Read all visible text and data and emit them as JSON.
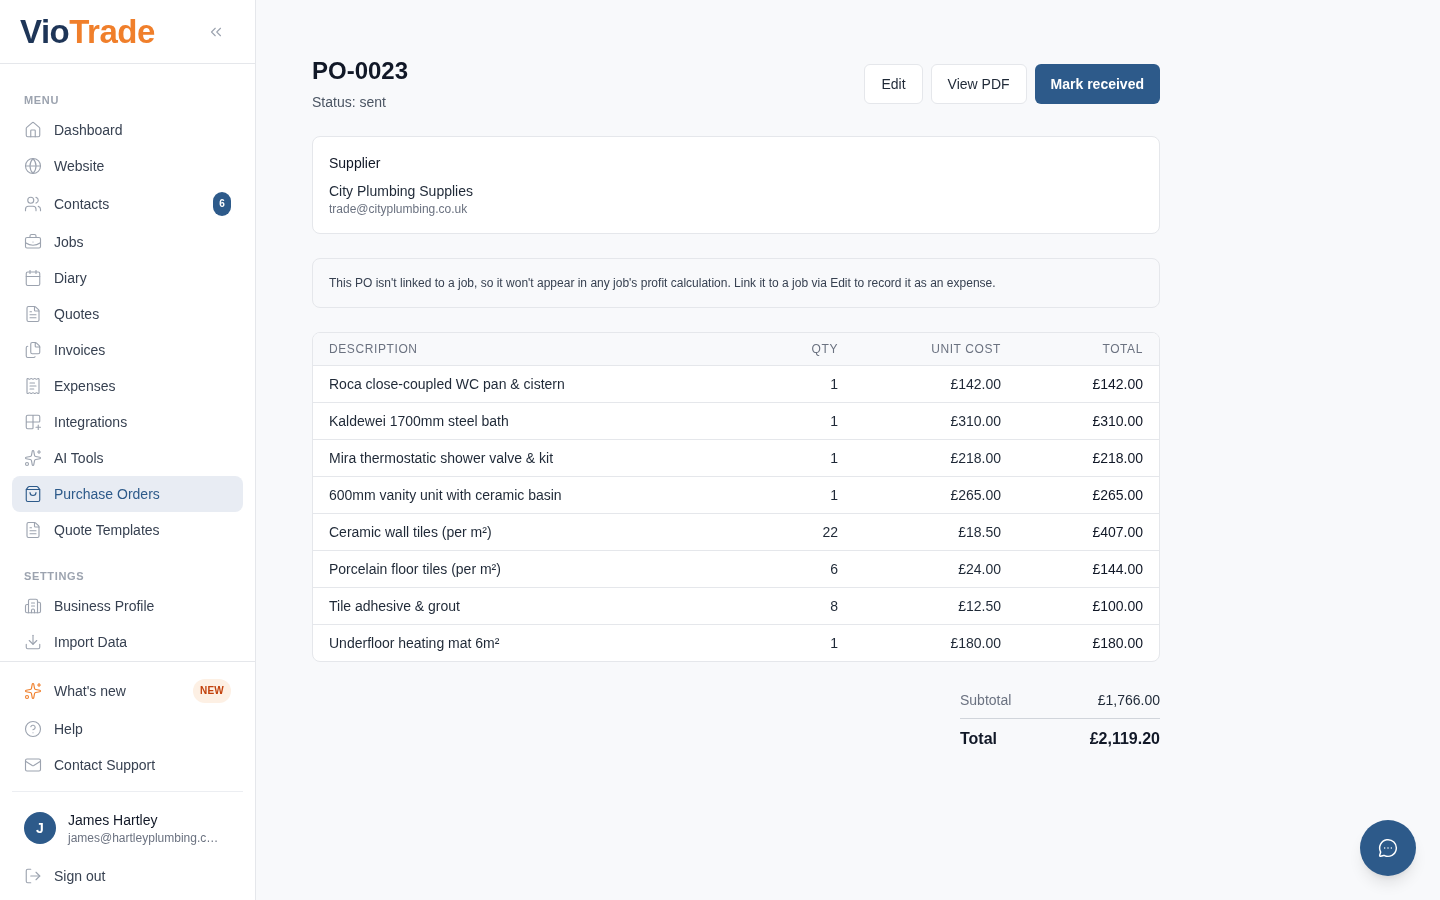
{
  "sidebar": {
    "logo": {
      "dark_part": "Vio",
      "accent_part": "Trade"
    },
    "sections": [
      {
        "heading": "MENU",
        "items": [
          {
            "label": "Dashboard",
            "selected": false
          },
          {
            "label": "Website",
            "selected": false
          },
          {
            "label": "Contacts",
            "selected": false,
            "badge": {
              "text": "6",
              "kind": "count"
            }
          },
          {
            "label": "Jobs",
            "selected": false
          },
          {
            "label": "Diary",
            "selected": false
          },
          {
            "label": "Quotes",
            "selected": false
          },
          {
            "label": "Invoices",
            "selected": false
          },
          {
            "label": "Expenses",
            "selected": false
          },
          {
            "label": "Integrations",
            "selected": false
          },
          {
            "label": "AI Tools",
            "selected": false
          },
          {
            "label": "Purchase Orders",
            "selected": true
          },
          {
            "label": "Quote Templates",
            "selected": false
          }
        ]
      },
      {
        "heading": "SETTINGS",
        "items": [
          {
            "label": "Business Profile",
            "selected": false
          },
          {
            "label": "Import Data",
            "selected": false
          }
        ]
      }
    ],
    "footer_items": [
      {
        "label": "What's new",
        "selected": false,
        "badge": {
          "text": "NEW",
          "kind": "new"
        }
      },
      {
        "label": "Help",
        "selected": false
      },
      {
        "label": "Contact Support",
        "selected": false
      }
    ],
    "user": {
      "initial": "J",
      "name": "James Hartley",
      "email": "james@hartleyplumbing.c…"
    },
    "sign_out": "Sign out"
  },
  "header": {
    "title": "PO-0023",
    "status": "Status: sent",
    "actions": [
      {
        "label": "Edit",
        "kind": "secondary"
      },
      {
        "label": "View PDF",
        "kind": "secondary"
      },
      {
        "label": "Mark received",
        "kind": "primary"
      }
    ]
  },
  "supplier": {
    "heading": "Supplier",
    "name": "City Plumbing Supplies",
    "email": "trade@cityplumbing.co.uk"
  },
  "notice": "This PO isn't linked to a job, so it won't appear in any job's profit calculation. Link it to a job via Edit to record it as an expense.",
  "table": {
    "columns": [
      "DESCRIPTION",
      "QTY",
      "UNIT COST",
      "TOTAL"
    ],
    "rows": [
      [
        "Roca close-coupled WC pan & cistern",
        "1",
        "£142.00",
        "£142.00"
      ],
      [
        "Kaldewei 1700mm steel bath",
        "1",
        "£310.00",
        "£310.00"
      ],
      [
        "Mira thermostatic shower valve & kit",
        "1",
        "£218.00",
        "£218.00"
      ],
      [
        "600mm vanity unit with ceramic basin",
        "1",
        "£265.00",
        "£265.00"
      ],
      [
        "Ceramic wall tiles (per m²)",
        "22",
        "£18.50",
        "£407.00"
      ],
      [
        "Porcelain floor tiles (per m²)",
        "6",
        "£24.00",
        "£144.00"
      ],
      [
        "Tile adhesive & grout",
        "8",
        "£12.50",
        "£100.00"
      ],
      [
        "Underfloor heating mat 6m²",
        "1",
        "£180.00",
        "£180.00"
      ]
    ]
  },
  "totals": [
    {
      "label": "Subtotal",
      "value": "£1,766.00",
      "kind": "subtotal"
    },
    {
      "label": "Total",
      "value": "£2,119.20",
      "kind": "grand"
    }
  ]
}
